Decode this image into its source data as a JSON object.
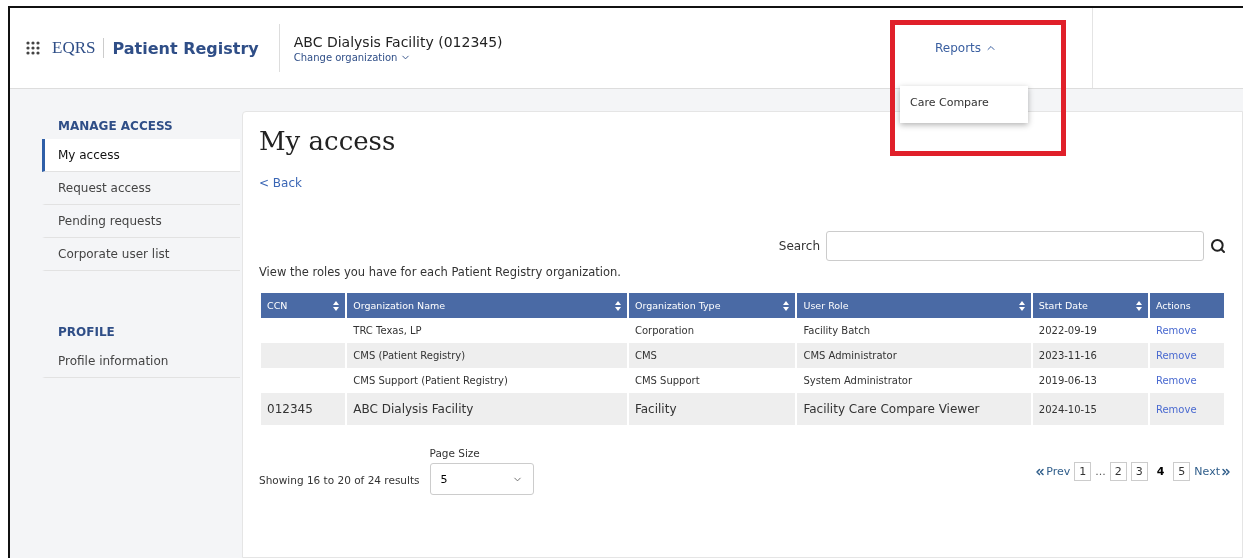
{
  "header": {
    "brand_prefix": "EQRS",
    "brand_name": "Patient Registry",
    "organization": "ABC Dialysis Facility (012345)",
    "change_link": "Change organization",
    "reports_menu": {
      "label": "Reports",
      "expanded": true,
      "items": [
        "Care Compare"
      ]
    }
  },
  "sidebar": {
    "sections": [
      {
        "title": "MANAGE ACCESS",
        "items": [
          {
            "label": "My access",
            "selected": true
          },
          {
            "label": "Request access",
            "selected": false
          },
          {
            "label": "Pending requests",
            "selected": false
          },
          {
            "label": "Corporate user list",
            "selected": false
          }
        ]
      },
      {
        "title": "PROFILE",
        "items": [
          {
            "label": "Profile information",
            "selected": false
          }
        ]
      }
    ]
  },
  "main": {
    "title": "My access",
    "back_link": "< Back",
    "search_label": "Search",
    "intro": "View the roles you have for each Patient Registry organization.",
    "table": {
      "columns": [
        {
          "label": "CCN",
          "sortable": true
        },
        {
          "label": "Organization Name",
          "sortable": true
        },
        {
          "label": "Organization Type",
          "sortable": true
        },
        {
          "label": "User Role",
          "sortable": true
        },
        {
          "label": "Start Date",
          "sortable": true
        },
        {
          "label": "Actions",
          "sortable": false
        }
      ],
      "rows": [
        [
          "",
          "TRC Texas, LP",
          "Corporation",
          "Facility Batch",
          "2022-09-19",
          "Remove"
        ],
        [
          "",
          "CMS (Patient Registry)",
          "CMS",
          "CMS Administrator",
          "2023-11-16",
          "Remove"
        ],
        [
          "",
          "CMS Support (Patient Registry)",
          "CMS Support",
          "System Administrator",
          "2019-06-13",
          "Remove"
        ],
        [
          "012345",
          "ABC Dialysis Facility",
          "Facility",
          "Facility Care Compare Viewer",
          "2024-10-15",
          "Remove"
        ]
      ]
    },
    "showing": "Showing 16 to 20 of 24 results",
    "page_size_label": "Page Size",
    "page_size": "5",
    "pagination": {
      "prev": "Prev",
      "next": "Next",
      "pages": [
        {
          "kind": "page",
          "label": "1",
          "selected": false
        },
        {
          "kind": "ellipsis",
          "label": "..."
        },
        {
          "kind": "page",
          "label": "2",
          "selected": false
        },
        {
          "kind": "page",
          "label": "3",
          "selected": false
        },
        {
          "kind": "page",
          "label": "4",
          "selected": true
        },
        {
          "kind": "page",
          "label": "5",
          "selected": false
        }
      ]
    }
  }
}
